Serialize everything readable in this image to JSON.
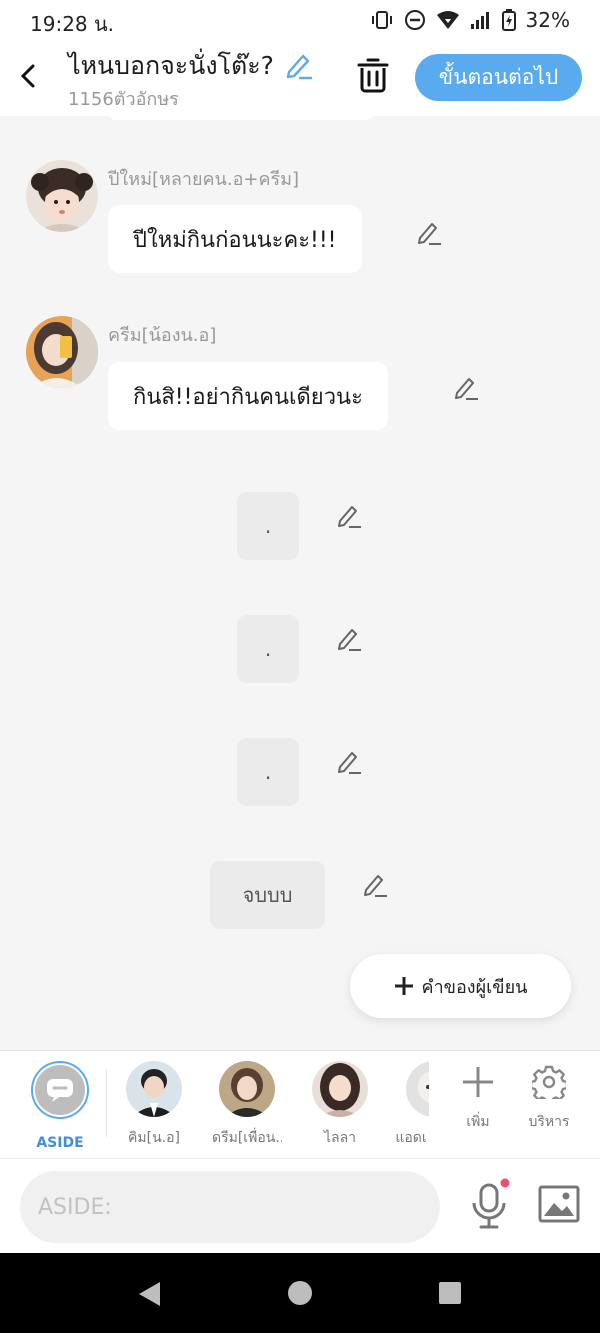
{
  "status_bar": {
    "time": "19:28 น.",
    "battery": "32%",
    "icons": [
      "vibrate-icon",
      "dnd-icon",
      "wifi-icon",
      "signal-icon",
      "battery-icon"
    ]
  },
  "header": {
    "title": "ไหนบอกจะนั่งโต๊ะ?",
    "char_count": "1156ตัวอักษร",
    "next_button": "ขั้นตอนต่อไป"
  },
  "messages": [
    {
      "speaker": "ปีใหม่[หลายคน.อ+ครีม]",
      "text": "ปีใหม่กินก่อนนะคะ!!!"
    },
    {
      "speaker": "ครีม[น้องน.อ]",
      "text": "กินสิ!!อย่ากินคนเดียวนะ"
    }
  ],
  "narrations": [
    ".",
    ".",
    ".",
    "จบบบ"
  ],
  "author_button": "คำของผู้เขียน",
  "characters": {
    "aside_label": "ASIDE",
    "items": [
      {
        "label": "คิม[น.อ]"
      },
      {
        "label": "ดรีม[เพื่อน..."
      },
      {
        "label": "ไลลา"
      },
      {
        "label": "แอดเ"
      }
    ],
    "add_label": "เพิ่ม",
    "manage_label": "บริหาร"
  },
  "input": {
    "placeholder": "ASIDE:"
  },
  "colors": {
    "accent": "#5aaaf0",
    "background": "#f5f5f5",
    "notification_dot": "#f0506e"
  }
}
